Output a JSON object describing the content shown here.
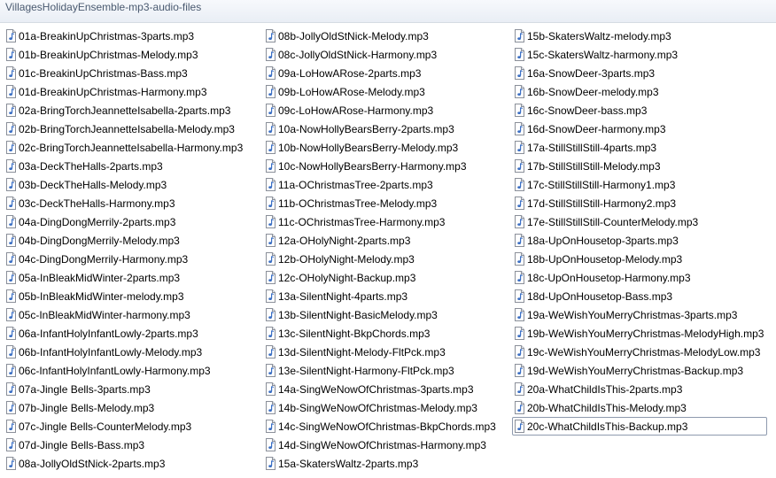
{
  "window": {
    "title": "VillagesHolidayEnsemble-mp3-audio-files"
  },
  "icon": "mp3-audio-file-icon",
  "columns": [
    [
      "01a-BreakinUpChristmas-3parts.mp3",
      "01b-BreakinUpChristmas-Melody.mp3",
      "01c-BreakinUpChristmas-Bass.mp3",
      "01d-BreakinUpChristmas-Harmony.mp3",
      "02a-BringTorchJeannetteIsabella-2parts.mp3",
      "02b-BringTorchJeannetteIsabella-Melody.mp3",
      "02c-BringTorchJeannetteIsabella-Harmony.mp3",
      "03a-DeckTheHalls-2parts.mp3",
      "03b-DeckTheHalls-Melody.mp3",
      "03c-DeckTheHalls-Harmony.mp3",
      "04a-DingDongMerrily-2parts.mp3",
      "04b-DingDongMerrily-Melody.mp3",
      "04c-DingDongMerrily-Harmony.mp3",
      "05a-InBleakMidWinter-2parts.mp3",
      "05b-InBleakMidWinter-melody.mp3",
      "05c-InBleakMidWinter-harmony.mp3",
      "06a-InfantHolyInfantLowly-2parts.mp3",
      "06b-InfantHolyInfantLowly-Melody.mp3",
      "06c-InfantHolyInfantLowly-Harmony.mp3",
      "07a-Jingle Bells-3parts.mp3",
      "07b-Jingle Bells-Melody.mp3",
      "07c-Jingle Bells-CounterMelody.mp3",
      "07d-Jingle Bells-Bass.mp3",
      "08a-JollyOldStNick-2parts.mp3"
    ],
    [
      "08b-JollyOldStNick-Melody.mp3",
      "08c-JollyOldStNick-Harmony.mp3",
      "09a-LoHowARose-2parts.mp3",
      "09b-LoHowARose-Melody.mp3",
      "09c-LoHowARose-Harmony.mp3",
      "10a-NowHollyBearsBerry-2parts.mp3",
      "10b-NowHollyBearsBerry-Melody.mp3",
      "10c-NowHollyBearsBerry-Harmony.mp3",
      "11a-OChristmasTree-2parts.mp3",
      "11b-OChristmasTree-Melody.mp3",
      "11c-OChristmasTree-Harmony.mp3",
      "12a-OHolyNight-2parts.mp3",
      "12b-OHolyNight-Melody.mp3",
      "12c-OHolyNight-Backup.mp3",
      "13a-SilentNight-4parts.mp3",
      "13b-SilentNight-BasicMelody.mp3",
      "13c-SilentNight-BkpChords.mp3",
      "13d-SilentNight-Melody-FltPck.mp3",
      "13e-SilentNight-Harmony-FltPck.mp3",
      "14a-SingWeNowOfChristmas-3parts.mp3",
      "14b-SingWeNowOfChristmas-Melody.mp3",
      "14c-SingWeNowOfChristmas-BkpChords.mp3",
      "14d-SingWeNowOfChristmas-Harmony.mp3",
      "15a-SkatersWaltz-2parts.mp3"
    ],
    [
      "15b-SkatersWaltz-melody.mp3",
      "15c-SkatersWaltz-harmony.mp3",
      "16a-SnowDeer-3parts.mp3",
      "16b-SnowDeer-melody.mp3",
      "16c-SnowDeer-bass.mp3",
      "16d-SnowDeer-harmony.mp3",
      "17a-StillStillStill-4parts.mp3",
      "17b-StillStillStill-Melody.mp3",
      "17c-StillStillStill-Harmony1.mp3",
      "17d-StillStillStill-Harmony2.mp3",
      "17e-StillStillStill-CounterMelody.mp3",
      "18a-UpOnHousetop-3parts.mp3",
      "18b-UpOnHousetop-Melody.mp3",
      "18c-UpOnHousetop-Harmony.mp3",
      "18d-UpOnHousetop-Bass.mp3",
      "19a-WeWishYouMerryChristmas-3parts.mp3",
      "19b-WeWishYouMerryChristmas-MelodyHigh.mp3",
      "19c-WeWishYouMerryChristmas-MelodyLow.mp3",
      "19d-WeWishYouMerryChristmas-Backup.mp3",
      "20a-WhatChildIsThis-2parts.mp3",
      "20b-WhatChildIsThis-Melody.mp3",
      "20c-WhatChildIsThis-Backup.mp3"
    ]
  ],
  "selected": "20c-WhatChildIsThis-Backup.mp3",
  "colors": {
    "title_text": "#4a5a70",
    "selection_border": "#8e9aae",
    "icon_note": "#3b6fc4"
  }
}
